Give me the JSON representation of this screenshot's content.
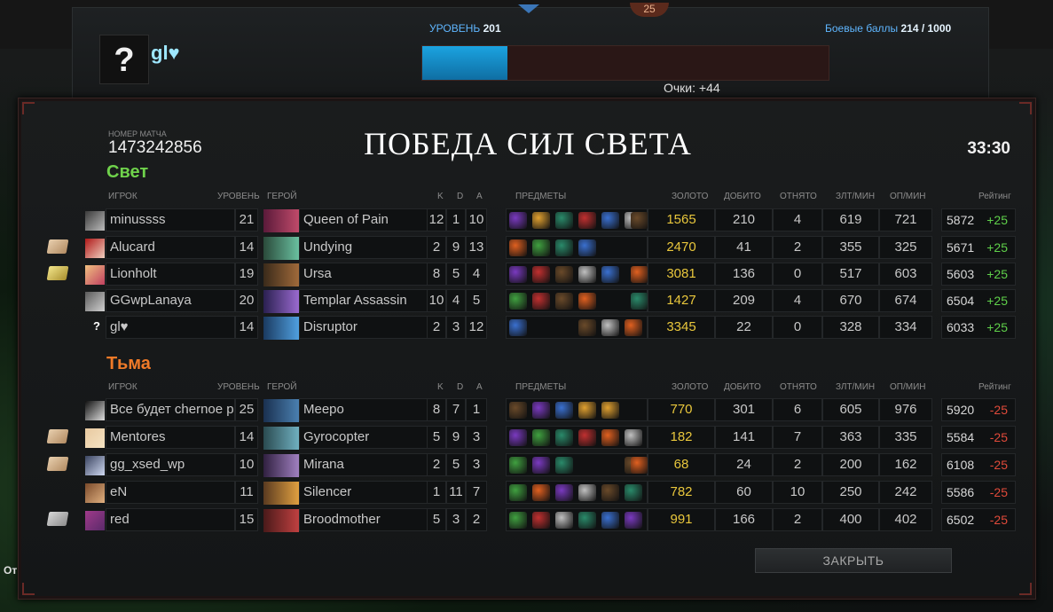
{
  "top": {
    "badge": "25",
    "player_name": "gl♥",
    "avatar_symbol": "?",
    "level_label": "УРОВЕНЬ",
    "level_value": "201",
    "xp_fill_fraction": 0.21,
    "points": "Очки: +44",
    "battle_points_label": "Боевые баллы",
    "battle_points_value": "214 / 1000"
  },
  "match": {
    "number_label": "НОМЕР МАТЧА",
    "number": "1473242856",
    "result": "ПОБЕДА СИЛ СВЕТА",
    "duration": "33:30"
  },
  "headers": {
    "player": "ИГРОК",
    "level": "УРОВЕНЬ",
    "hero": "ГЕРОЙ",
    "k": "K",
    "d": "D",
    "a": "A",
    "items": "ПРЕДМЕТЫ",
    "gold": "ЗОЛОТО",
    "last_hits": "ДОБИТО",
    "denies": "ОТНЯТО",
    "gpm": "ЗЛТ/МИН",
    "xpm": "ОП/МИН",
    "rating": "Рейтинг"
  },
  "radiant": {
    "title": "Свет",
    "players": [
      {
        "accessory": "none",
        "name": "minussss",
        "level": "21",
        "hero": "Queen of Pain",
        "k": "12",
        "d": "1",
        "a": "10",
        "gold": "1565",
        "lh": "210",
        "dn": "4",
        "gpm": "619",
        "xpm": "721",
        "rating": "5872",
        "delta": "+25"
      },
      {
        "accessory": "book",
        "name": "Alucard",
        "level": "14",
        "hero": "Undying",
        "k": "2",
        "d": "9",
        "a": "13",
        "gold": "2470",
        "lh": "41",
        "dn": "2",
        "gpm": "355",
        "xpm": "325",
        "rating": "5671",
        "delta": "+25"
      },
      {
        "accessory": "gold",
        "name": "Lionholt",
        "level": "19",
        "hero": "Ursa",
        "k": "8",
        "d": "5",
        "a": "4",
        "gold": "3081",
        "lh": "136",
        "dn": "0",
        "gpm": "517",
        "xpm": "603",
        "rating": "5603",
        "delta": "+25"
      },
      {
        "accessory": "none",
        "name": "GGwpLanaya",
        "level": "20",
        "hero": "Templar Assassin",
        "k": "10",
        "d": "4",
        "a": "5",
        "gold": "1427",
        "lh": "209",
        "dn": "4",
        "gpm": "670",
        "xpm": "674",
        "rating": "6504",
        "delta": "+25"
      },
      {
        "accessory": "question",
        "name": "gl♥",
        "level": "14",
        "hero": "Disruptor",
        "k": "2",
        "d": "3",
        "a": "12",
        "gold": "3345",
        "lh": "22",
        "dn": "0",
        "gpm": "328",
        "xpm": "334",
        "rating": "6033",
        "delta": "+25"
      }
    ]
  },
  "dire": {
    "title": "Тьма",
    "players": [
      {
        "accessory": "none",
        "name": "Все будет chernoe piz",
        "level": "25",
        "hero": "Meepo",
        "k": "8",
        "d": "7",
        "a": "1",
        "gold": "770",
        "lh": "301",
        "dn": "6",
        "gpm": "605",
        "xpm": "976",
        "rating": "5920",
        "delta": "-25"
      },
      {
        "accessory": "book",
        "name": "Mentores",
        "level": "14",
        "hero": "Gyrocopter",
        "k": "5",
        "d": "9",
        "a": "3",
        "gold": "182",
        "lh": "141",
        "dn": "7",
        "gpm": "363",
        "xpm": "335",
        "rating": "5584",
        "delta": "-25"
      },
      {
        "accessory": "book",
        "name": "gg_xsed_wp",
        "level": "10",
        "hero": "Mirana",
        "k": "2",
        "d": "5",
        "a": "3",
        "gold": "68",
        "lh": "24",
        "dn": "2",
        "gpm": "200",
        "xpm": "162",
        "rating": "6108",
        "delta": "-25"
      },
      {
        "accessory": "none",
        "name": "eN",
        "level": "11",
        "hero": "Silencer",
        "k": "1",
        "d": "11",
        "a": "7",
        "gold": "782",
        "lh": "60",
        "dn": "10",
        "gpm": "250",
        "xpm": "242",
        "rating": "5586",
        "delta": "-25"
      },
      {
        "accessory": "grey",
        "name": "red",
        "level": "15",
        "hero": "Broodmother",
        "k": "5",
        "d": "3",
        "a": "2",
        "gold": "991",
        "lh": "166",
        "dn": "2",
        "gpm": "400",
        "xpm": "402",
        "rating": "6502",
        "delta": "-25"
      }
    ]
  },
  "close_button": "ЗАКРЫТЬ",
  "side_text": "От"
}
